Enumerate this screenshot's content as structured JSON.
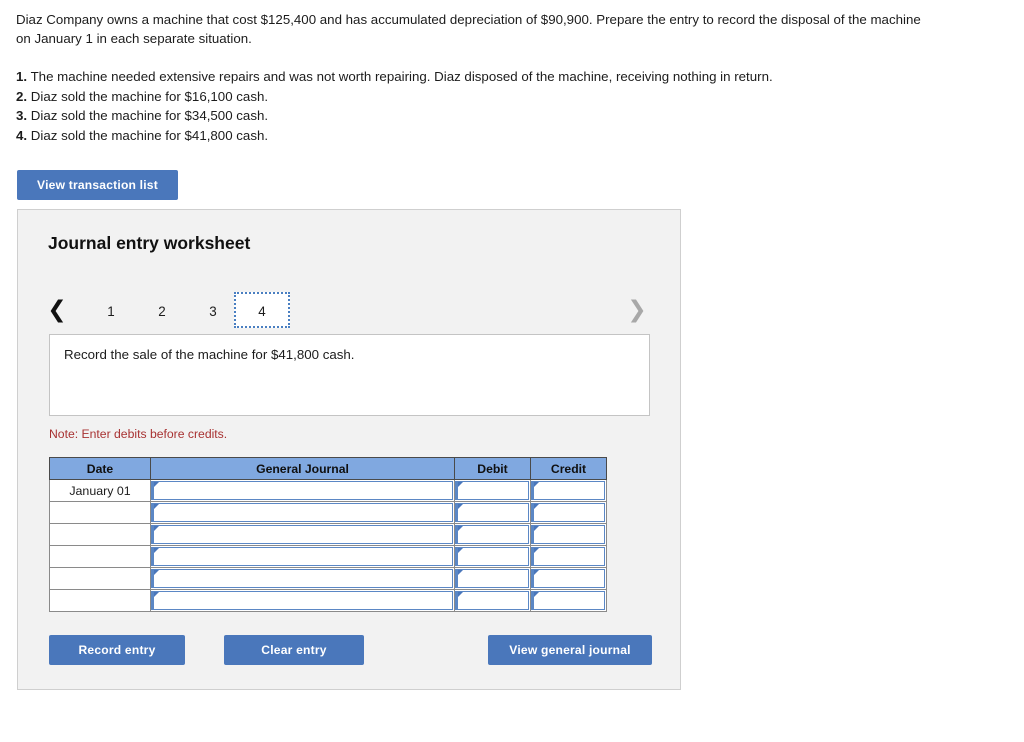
{
  "problem": {
    "statement": "Diaz Company owns a machine that cost $125,400 and has accumulated depreciation of $90,900. Prepare the entry to record the disposal of the machine on January 1 in each separate situation.",
    "situations": [
      {
        "num": "1.",
        "text": "The machine needed extensive repairs and was not worth repairing. Diaz disposed of the machine, receiving nothing in return."
      },
      {
        "num": "2.",
        "text": "Diaz sold the machine for $16,100 cash."
      },
      {
        "num": "3.",
        "text": "Diaz sold the machine for $34,500 cash."
      },
      {
        "num": "4.",
        "text": "Diaz sold the machine for $41,800 cash."
      }
    ]
  },
  "toolbar": {
    "view_transaction_list": "View transaction list"
  },
  "worksheet": {
    "title": "Journal entry worksheet",
    "nav": {
      "prev_icon": "chevron-left",
      "next_icon": "chevron-right",
      "tabs": [
        {
          "label": "1",
          "selected": false
        },
        {
          "label": "2",
          "selected": false
        },
        {
          "label": "3",
          "selected": false
        },
        {
          "label": "4",
          "selected": true
        }
      ]
    },
    "instruction": "Record the sale of the machine for $41,800 cash.",
    "note": "Note: Enter debits before credits.",
    "table": {
      "headers": [
        "Date",
        "General Journal",
        "Debit",
        "Credit"
      ],
      "rows": [
        {
          "date": "January 01",
          "general_journal": "",
          "debit": "",
          "credit": ""
        },
        {
          "date": "",
          "general_journal": "",
          "debit": "",
          "credit": ""
        },
        {
          "date": "",
          "general_journal": "",
          "debit": "",
          "credit": ""
        },
        {
          "date": "",
          "general_journal": "",
          "debit": "",
          "credit": ""
        },
        {
          "date": "",
          "general_journal": "",
          "debit": "",
          "credit": ""
        },
        {
          "date": "",
          "general_journal": "",
          "debit": "",
          "credit": ""
        }
      ]
    },
    "buttons": {
      "record_entry": "Record entry",
      "clear_entry": "Clear entry",
      "view_general_journal": "View general journal"
    }
  },
  "colors": {
    "button_blue": "#4a77bb",
    "table_header_blue": "#80a8e0",
    "note_red": "#a83232",
    "panel_bg": "#f2f2f2",
    "cell_border_blue": "#5b87c5"
  }
}
